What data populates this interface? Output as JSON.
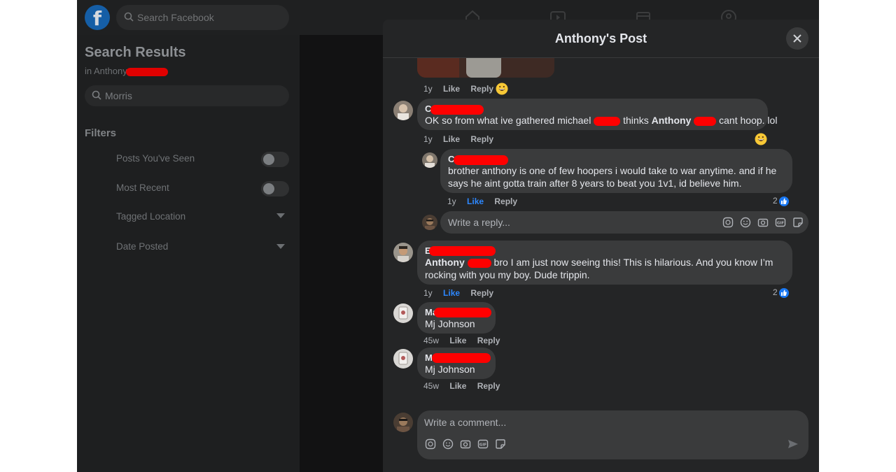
{
  "background": {
    "search_placeholder": "Search Facebook",
    "left": {
      "title": "Search Results",
      "subtitle_prefix": "in Anthony",
      "search_value": "Morris",
      "filters_title": "Filters",
      "filters": [
        {
          "label": "Posts You've Seen",
          "control": "toggle"
        },
        {
          "label": "Most Recent",
          "control": "toggle"
        },
        {
          "label": "Tagged Location",
          "control": "dropdown"
        },
        {
          "label": "Date Posted",
          "control": "dropdown"
        }
      ]
    }
  },
  "modal": {
    "title": "Anthony's Post",
    "close_icon": "close-icon",
    "top_actions": {
      "time": "1y",
      "like": "Like",
      "reply": "Reply",
      "reaction": "grinning-emoji"
    },
    "comments": [
      {
        "author_initial": "C",
        "text_1": "OK so from what ive gathered michael",
        "text_2": "thinks",
        "text_bold": "Anthony",
        "text_3": "cant hoop. lol",
        "time": "1y",
        "like": "Like",
        "reply": "Reply",
        "reaction": "grinning-emoji"
      },
      {
        "author_initial": "C",
        "text": "brother anthony is one of few hoopers i would take to war anytime. and if he says he aint gotta train after 8 years to beat you 1v1, id believe him.",
        "time": "1y",
        "like": "Like",
        "reply": "Reply",
        "like_count": "2",
        "liked": true
      },
      {
        "author_initial": "E",
        "text_bold": "Anthony",
        "text": "bro I am just now seeing this! This is hilarious. And you know I’m rocking with you my boy. Dude trippin.",
        "time": "1y",
        "like": "Like",
        "reply": "Reply",
        "like_count": "2",
        "liked": true
      },
      {
        "author_initial": "Ma",
        "text": "Mj Johnson",
        "time": "45w",
        "like": "Like",
        "reply": "Reply"
      },
      {
        "author_initial": "M",
        "text": "Mj Johnson",
        "time": "45w",
        "like": "Like",
        "reply": "Reply"
      }
    ],
    "reply_placeholder": "Write a reply...",
    "comment_placeholder": "Write a comment...",
    "composer_icons": [
      "avatar-sticker-icon",
      "emoji-icon",
      "camera-icon",
      "gif-icon",
      "sticker-icon"
    ],
    "colors": {
      "accent": "#2d88ff",
      "redaction": "#ff0000",
      "bubble": "#3a3b3c"
    }
  }
}
